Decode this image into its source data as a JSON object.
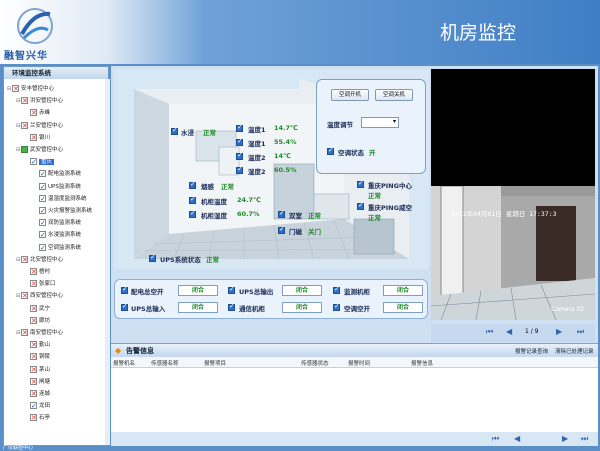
{
  "header": {
    "logo_text": "融智兴华",
    "title": "机房监控"
  },
  "sidebar": {
    "title": "环境监控系统",
    "items": [
      {
        "label": "安丰管控中心",
        "lvl": 0,
        "icon": "x"
      },
      {
        "label": "洪安管控中心",
        "lvl": 1,
        "icon": "x"
      },
      {
        "label": "赤峰",
        "lvl": 2,
        "icon": "x"
      },
      {
        "label": "兰安管控中心",
        "lvl": 1,
        "icon": "x"
      },
      {
        "label": "银川",
        "lvl": 2,
        "icon": "x"
      },
      {
        "label": "武安管控中心",
        "lvl": 1,
        "icon": "g"
      },
      {
        "label": "重庆",
        "lvl": 2,
        "icon": "c",
        "sel": true
      },
      {
        "label": "配电监测系统",
        "lvl": 3,
        "icon": "c"
      },
      {
        "label": "UPS监测系统",
        "lvl": 3,
        "icon": "c"
      },
      {
        "label": "温湿度监测系统",
        "lvl": 3,
        "icon": "c"
      },
      {
        "label": "火灾报警监测系统",
        "lvl": 3,
        "icon": "c"
      },
      {
        "label": "双防监测系统",
        "lvl": 3,
        "icon": "c"
      },
      {
        "label": "水浸监测系统",
        "lvl": 3,
        "icon": "c"
      },
      {
        "label": "空调监测系统",
        "lvl": 3,
        "icon": "c"
      },
      {
        "label": "北安管控中心",
        "lvl": 1,
        "icon": "x"
      },
      {
        "label": "梧村",
        "lvl": 2,
        "icon": "x"
      },
      {
        "label": "张家口",
        "lvl": 2,
        "icon": "x"
      },
      {
        "label": "西安管控中心",
        "lvl": 1,
        "icon": "x"
      },
      {
        "label": "武宁",
        "lvl": 2,
        "icon": "x"
      },
      {
        "label": "廊坊",
        "lvl": 2,
        "icon": "x"
      },
      {
        "label": "南安管控中心",
        "lvl": 1,
        "icon": "x"
      },
      {
        "label": "勤山",
        "lvl": 2,
        "icon": "x"
      },
      {
        "label": "铜陵",
        "lvl": 2,
        "icon": "x"
      },
      {
        "label": "茅山",
        "lvl": 2,
        "icon": "x"
      },
      {
        "label": "闸塘",
        "lvl": 2,
        "icon": "x"
      },
      {
        "label": "连城",
        "lvl": 2,
        "icon": "x"
      },
      {
        "label": "龙田",
        "lvl": 2,
        "icon": "c"
      },
      {
        "label": "石亭",
        "lvl": 2,
        "icon": "x"
      }
    ]
  },
  "scene": {
    "water": {
      "label": "水浸",
      "value": "正常"
    },
    "temp1": {
      "label": "温度1",
      "value": "14.7℃"
    },
    "hum1": {
      "label": "湿度1",
      "value": "55.4%"
    },
    "temp2": {
      "label": "温度2",
      "value": "14℃"
    },
    "hum2": {
      "label": "湿度2",
      "value": "60.5%"
    },
    "smoke": {
      "label": "烟感",
      "value": "正常"
    },
    "cab_temp": {
      "label": "机柜温度",
      "value": "24.7℃"
    },
    "cab_hum": {
      "label": "机柜湿度",
      "value": "60.7%"
    },
    "ups": {
      "label": "UPS系统状态",
      "value": "正常"
    },
    "door_side": {
      "label": "双室",
      "value": "正常"
    },
    "door": {
      "label": "门磁",
      "value": "关门"
    },
    "ping1": {
      "label": "重庆PING中心",
      "value": "正常"
    },
    "ping2": {
      "label": "重庆PING威空",
      "value": "正常"
    }
  },
  "control": {
    "btn_on": "空调开机",
    "btn_off": "空调关机",
    "temp_adjust": "温度调节",
    "ac_status": "空调状态",
    "ac_value": "开"
  },
  "status": [
    {
      "label": "配电总空开",
      "value": "闭合"
    },
    {
      "label": "UPS总输出",
      "value": "闭合"
    },
    {
      "label": "监测机柜",
      "value": "闭合"
    },
    {
      "label": "UPS总输入",
      "value": "闭合"
    },
    {
      "label": "通信机柜",
      "value": "闭合"
    },
    {
      "label": "空调空开",
      "value": "闭合"
    }
  ],
  "camera": {
    "timestamp": "2012年04月01日 星期日 17:37:3",
    "name": "Camera 02"
  },
  "pager": {
    "text": "1 / 9"
  },
  "alarm": {
    "title": "告警信息",
    "link1": "报警记录查询",
    "link2": "清除已处理记录",
    "columns": [
      "报警机名",
      "传感器名称",
      "报警项目",
      "传感器状态",
      "报警时间",
      "报警信息"
    ]
  },
  "footer": "广仪联检中心"
}
